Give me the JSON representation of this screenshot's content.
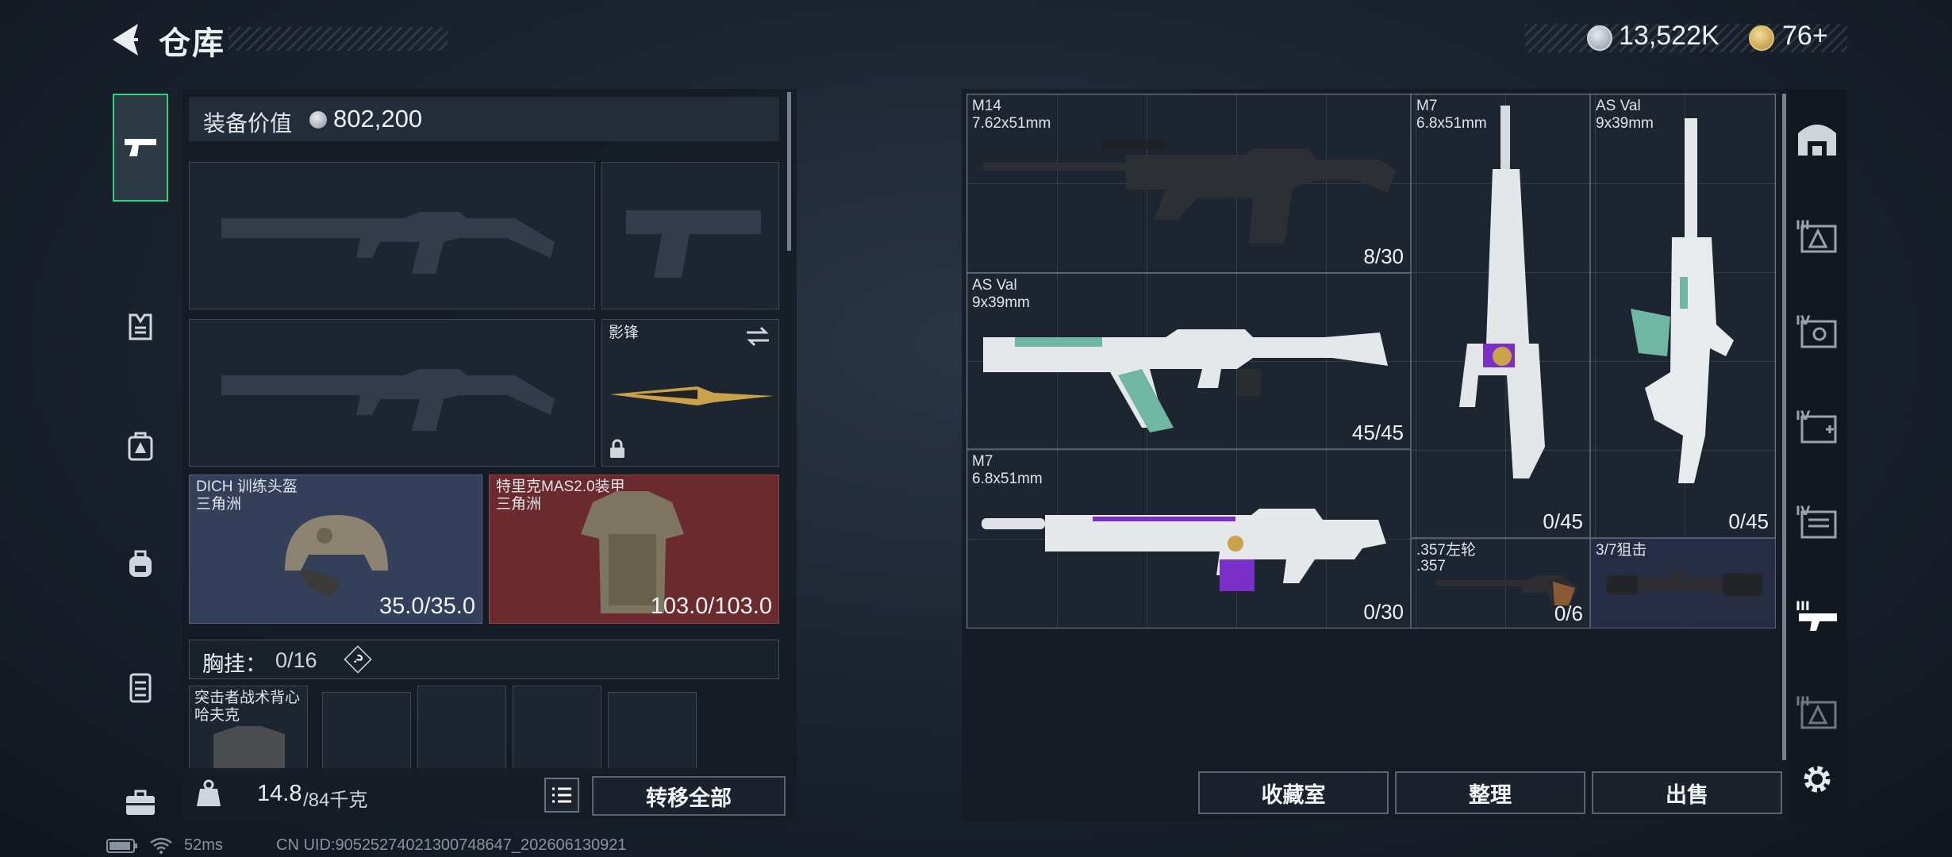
{
  "header": {
    "title": "仓库",
    "currency_value": "13,522K",
    "coin_value": "76+"
  },
  "loadout": {
    "equipment_value_label": "装备价值",
    "equipment_value": "802,200",
    "melee": {
      "name": "影锋"
    },
    "helmet": {
      "name": "DICH 训练头盔",
      "faction": "三角洲",
      "durability": "35.0/35.0"
    },
    "armor": {
      "name": "特里克MAS2.0装甲",
      "faction": "三角洲",
      "durability": "103.0/103.0"
    },
    "chest_rig": {
      "label": "胸挂：",
      "capacity": "0/16",
      "help": "?"
    },
    "backpack": {
      "name": "突击者战术背心",
      "sub": "哈夫克"
    },
    "weight_current": "14.8",
    "weight_max": "/84千克",
    "transfer_all": "转移全部"
  },
  "storage": {
    "items": [
      {
        "name": "M14",
        "caliber": "7.62x51mm",
        "count": "8/30"
      },
      {
        "name": "M7",
        "caliber": "6.8x51mm",
        "count": "0/45"
      },
      {
        "name": "AS Val",
        "caliber": "9x39mm",
        "count": "0/45"
      },
      {
        "name": "AS Val",
        "caliber": "9x39mm",
        "count": "45/45"
      },
      {
        "name": "M7",
        "caliber": "6.8x51mm",
        "count": "0/30"
      },
      {
        "name": ".357左轮",
        "caliber": ".357",
        "count": "0/6"
      },
      {
        "name": "3/7狙击",
        "caliber": "",
        "count": ""
      }
    ],
    "buttons": {
      "collection": "收藏室",
      "sort": "整理",
      "sell": "出售"
    }
  },
  "status": {
    "ping": "52ms",
    "uid": "CN UID:90525274021300748647_202606130921"
  },
  "colors": {
    "accent_green": "#2fd47a",
    "helmet_bg": "#34405a",
    "armor_bg": "#6a2a2e",
    "purple": "#7a2fc8",
    "teal": "#6fb7a3"
  }
}
